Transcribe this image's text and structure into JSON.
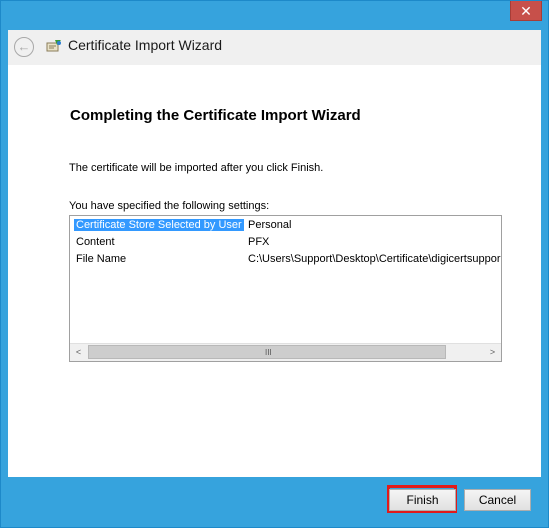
{
  "window": {
    "title": "Certificate Import Wizard",
    "close_label": "✕"
  },
  "header": {
    "back_icon": "back-arrow-icon",
    "app_icon": "certificate-icon"
  },
  "page": {
    "heading": "Completing the Certificate Import Wizard",
    "description": "The certificate will be imported after you click Finish.",
    "settings_label": "You have specified the following settings:"
  },
  "settings": [
    {
      "key": "Certificate Store Selected by User",
      "value": "Personal",
      "selected": true
    },
    {
      "key": "Content",
      "value": "PFX",
      "selected": false
    },
    {
      "key": "File Name",
      "value": "C:\\Users\\Support\\Desktop\\Certificate\\digicertsuppor",
      "selected": false
    }
  ],
  "scrollbar": {
    "left_arrow": "<",
    "right_arrow": ">",
    "grip": "III"
  },
  "buttons": {
    "finish": "Finish",
    "cancel": "Cancel"
  },
  "colors": {
    "frame": "#36a3dd",
    "close": "#c7504a",
    "selection": "#3399ff",
    "highlight": "#e11a1a"
  }
}
